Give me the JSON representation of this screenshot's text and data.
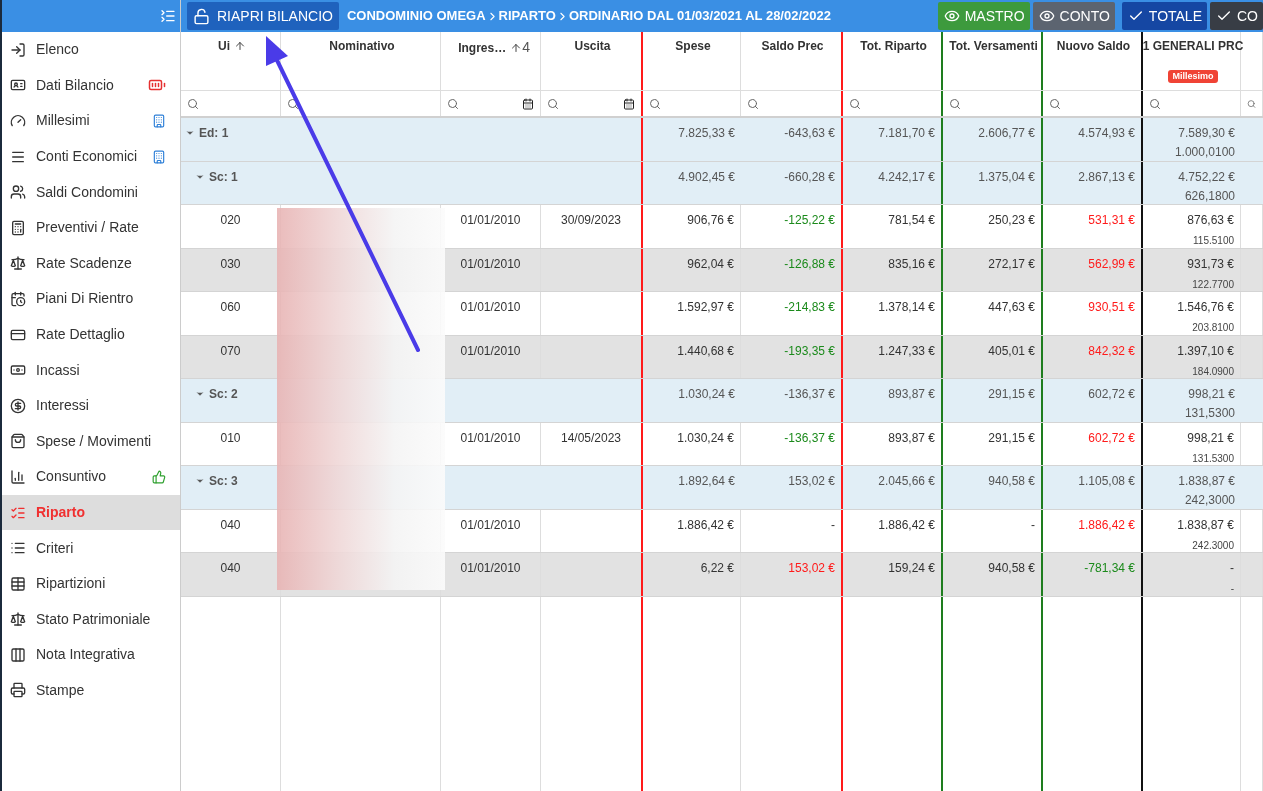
{
  "toolbar": {
    "reopen_button": "RIAPRI BILANCIO",
    "breadcrumb": [
      "CONDOMINIO OMEGA",
      "RIPARTO",
      "ORDINARIO DAL 01/03/2021 AL 28/02/2022"
    ],
    "toggles": [
      {
        "label": "MASTRO",
        "kind": "eye",
        "color": "#3d9a3d"
      },
      {
        "label": "CONTO",
        "kind": "eye",
        "color": "#5c6470"
      },
      {
        "label": "TOTALE",
        "kind": "check",
        "color": "#1547a3"
      },
      {
        "label": "CO",
        "kind": "check",
        "color": "#383d45"
      }
    ]
  },
  "sidebar": {
    "items": [
      {
        "label": "Elenco",
        "selected": false
      },
      {
        "label": "Dati Bilancio",
        "selected": false
      },
      {
        "label": "Millesimi",
        "selected": false
      },
      {
        "label": "Conti Economici",
        "selected": false
      },
      {
        "label": "Saldi Condomini",
        "selected": false
      },
      {
        "label": "Preventivi / Rate",
        "selected": false
      },
      {
        "label": "Rate Scadenze",
        "selected": false
      },
      {
        "label": "Piani Di Rientro",
        "selected": false
      },
      {
        "label": "Rate Dettaglio",
        "selected": false
      },
      {
        "label": "Incassi",
        "selected": false
      },
      {
        "label": "Interessi",
        "selected": false
      },
      {
        "label": "Spese / Movimenti",
        "selected": false
      },
      {
        "label": "Consuntivo",
        "selected": false
      },
      {
        "label": "Riparto",
        "selected": true
      },
      {
        "label": "Criteri",
        "selected": false
      },
      {
        "label": "Ripartizioni",
        "selected": false
      },
      {
        "label": "Stato Patrimoniale",
        "selected": false
      },
      {
        "label": "Nota Integrativa",
        "selected": false
      },
      {
        "label": "Stampe",
        "selected": false
      }
    ]
  },
  "table": {
    "columns": [
      {
        "label": "Ui",
        "sorted": true,
        "date_filter": false
      },
      {
        "label": "Nominativo",
        "date_filter": false
      },
      {
        "label": "Ingres…",
        "sorted": true,
        "sort_index": "4",
        "date_filter": true
      },
      {
        "label": "Uscita",
        "date_filter": true
      },
      {
        "label": "Spese",
        "date_filter": false
      },
      {
        "label": "Saldo Prec",
        "date_filter": false
      },
      {
        "label": "Tot. Riparto",
        "date_filter": false
      },
      {
        "label": "Tot. Versamenti",
        "date_filter": false
      },
      {
        "label": "Nuovo Saldo",
        "date_filter": false
      },
      {
        "label": "1 GENERALI PRC",
        "date_filter": false,
        "badge": "Millesimo"
      },
      {
        "date_filter": false
      }
    ],
    "rows": [
      {
        "kind": "group",
        "expanded": true,
        "cells": [
          {
            "text": "Ed: 1"
          },
          {
            "text": ""
          },
          {
            "text": ""
          },
          {
            "text": ""
          },
          {
            "text": "7.825,33 €"
          },
          {
            "text": "-643,63 €"
          },
          {
            "text": "7.181,70 €"
          },
          {
            "text": "2.606,77 €"
          },
          {
            "text": "4.574,93 €"
          },
          {
            "text": "7.589,30 €",
            "sub": "1.000,0100"
          }
        ],
        "children": [
          {
            "kind": "group",
            "expanded": true,
            "cells": [
              {
                "text": "Sc: 1"
              },
              {
                "text": ""
              },
              {
                "text": ""
              },
              {
                "text": ""
              },
              {
                "text": "4.902,45 €"
              },
              {
                "text": "-660,28 €"
              },
              {
                "text": "4.242,17 €"
              },
              {
                "text": "1.375,04 €"
              },
              {
                "text": "2.867,13 €"
              },
              {
                "text": "4.752,22 €",
                "sub": "626,1800"
              }
            ],
            "children": [
              {
                "kind": "unit",
                "cells": [
                  {
                    "text": "020"
                  },
                  {
                    "text": ""
                  },
                  {
                    "text": "01/01/2010"
                  },
                  {
                    "text": "30/09/2023"
                  },
                  {
                    "text": "906,76 €"
                  },
                  {
                    "text": "-125,22 €",
                    "color": "#1b8a1b"
                  },
                  {
                    "text": "781,54 €"
                  },
                  {
                    "text": "250,23 €"
                  },
                  {
                    "text": "531,31 €",
                    "color": "#ff1a1a"
                  },
                  {
                    "text": "876,63 €",
                    "sub": "115.5100"
                  }
                ]
              },
              {
                "kind": "unit",
                "cells": [
                  {
                    "text": "030"
                  },
                  {
                    "text": ""
                  },
                  {
                    "text": "01/01/2010"
                  },
                  {
                    "text": ""
                  },
                  {
                    "text": "962,04 €"
                  },
                  {
                    "text": "-126,88 €",
                    "color": "#1b8a1b"
                  },
                  {
                    "text": "835,16 €"
                  },
                  {
                    "text": "272,17 €"
                  },
                  {
                    "text": "562,99 €",
                    "color": "#ff1a1a"
                  },
                  {
                    "text": "931,73 €",
                    "sub": "122.7700"
                  }
                ]
              },
              {
                "kind": "unit",
                "cells": [
                  {
                    "text": "060"
                  },
                  {
                    "text": ""
                  },
                  {
                    "text": "01/01/2010"
                  },
                  {
                    "text": ""
                  },
                  {
                    "text": "1.592,97 €"
                  },
                  {
                    "text": "-214,83 €",
                    "color": "#1b8a1b"
                  },
                  {
                    "text": "1.378,14 €"
                  },
                  {
                    "text": "447,63 €"
                  },
                  {
                    "text": "930,51 €",
                    "color": "#ff1a1a"
                  },
                  {
                    "text": "1.546,76 €",
                    "sub": "203.8100"
                  }
                ]
              },
              {
                "kind": "unit",
                "cells": [
                  {
                    "text": "070"
                  },
                  {
                    "text": ""
                  },
                  {
                    "text": "01/01/2010"
                  },
                  {
                    "text": ""
                  },
                  {
                    "text": "1.440,68 €"
                  },
                  {
                    "text": "-193,35 €",
                    "color": "#1b8a1b"
                  },
                  {
                    "text": "1.247,33 €"
                  },
                  {
                    "text": "405,01 €"
                  },
                  {
                    "text": "842,32 €",
                    "color": "#ff1a1a"
                  },
                  {
                    "text": "1.397,10 €",
                    "sub": "184.0900"
                  }
                ]
              }
            ]
          },
          {
            "kind": "group",
            "expanded": true,
            "cells": [
              {
                "text": "Sc: 2"
              },
              {
                "text": ""
              },
              {
                "text": ""
              },
              {
                "text": ""
              },
              {
                "text": "1.030,24 €"
              },
              {
                "text": "-136,37 €"
              },
              {
                "text": "893,87 €"
              },
              {
                "text": "291,15 €"
              },
              {
                "text": "602,72 €"
              },
              {
                "text": "998,21 €",
                "sub": "131,5300"
              }
            ],
            "children": [
              {
                "kind": "unit",
                "cells": [
                  {
                    "text": "010"
                  },
                  {
                    "text": ""
                  },
                  {
                    "text": "01/01/2010"
                  },
                  {
                    "text": "14/05/2023"
                  },
                  {
                    "text": "1.030,24 €"
                  },
                  {
                    "text": "-136,37 €",
                    "color": "#1b8a1b"
                  },
                  {
                    "text": "893,87 €"
                  },
                  {
                    "text": "291,15 €"
                  },
                  {
                    "text": "602,72 €",
                    "color": "#ff1a1a"
                  },
                  {
                    "text": "998,21 €",
                    "sub": "131.5300"
                  }
                ]
              }
            ]
          },
          {
            "kind": "group",
            "expanded": true,
            "cells": [
              {
                "text": "Sc: 3"
              },
              {
                "text": ""
              },
              {
                "text": ""
              },
              {
                "text": ""
              },
              {
                "text": "1.892,64 €"
              },
              {
                "text": "153,02 €"
              },
              {
                "text": "2.045,66 €"
              },
              {
                "text": "940,58 €"
              },
              {
                "text": "1.105,08 €"
              },
              {
                "text": "1.838,87 €",
                "sub": "242,3000"
              }
            ],
            "children": [
              {
                "kind": "unit",
                "cells": [
                  {
                    "text": "040"
                  },
                  {
                    "text": ""
                  },
                  {
                    "text": "01/01/2010"
                  },
                  {
                    "text": ""
                  },
                  {
                    "text": "1.886,42 €"
                  },
                  {
                    "text": "-"
                  },
                  {
                    "text": "1.886,42 €"
                  },
                  {
                    "text": "-"
                  },
                  {
                    "text": "1.886,42 €",
                    "color": "#ff1a1a"
                  },
                  {
                    "text": "1.838,87 €",
                    "sub": "242.3000"
                  }
                ]
              },
              {
                "kind": "unit",
                "cells": [
                  {
                    "text": "040"
                  },
                  {
                    "text": ""
                  },
                  {
                    "text": "01/01/2010"
                  },
                  {
                    "text": ""
                  },
                  {
                    "text": "6,22 €"
                  },
                  {
                    "text": "153,02 €",
                    "color": "#ff1a1a"
                  },
                  {
                    "text": "159,24 €"
                  },
                  {
                    "text": "940,58 €"
                  },
                  {
                    "text": "-781,34 €",
                    "color": "#1b8a1b"
                  },
                  {
                    "text": "-",
                    "sub": "-"
                  }
                ]
              }
            ]
          }
        ]
      }
    ]
  }
}
